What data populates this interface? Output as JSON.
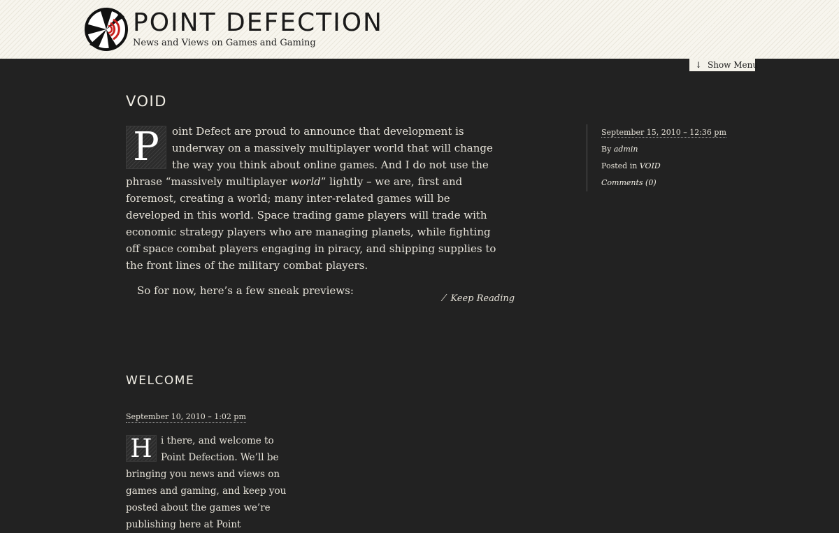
{
  "site": {
    "title": "POINT DEFECTION",
    "tagline": "News and Views on Games and Gaming"
  },
  "menu": {
    "toggle_label": "Show Menu",
    "toggle_icon": "down-arrow-icon"
  },
  "posts": [
    {
      "title": "VOID",
      "dropcap": "P",
      "lead": "oint Defect are proud to announce that development is underway on a massively multiplayer world that will change the way you think about online games. And I do not use the phrase “massively multiplayer ",
      "lead_em": "world",
      "lead_rest": "” lightly – we are, first and foremost, creating a world; many inter-related games will be developed in this world. Space trading game players will trade with economic strategy players who are managing planets, while fighting off space combat players engaging in piracy, and shipping supplies to the front lines of the military combat players.",
      "para2": "So for now, here’s a few sneak previews:",
      "keep_reading": "Keep Reading",
      "meta": {
        "date": "September 15, 2010 – 12:36 pm",
        "by_label": "By",
        "author": "admin",
        "posted_label": "Posted in",
        "category": "VOID",
        "comments": "Comments (0)"
      }
    },
    {
      "title": "WELCOME",
      "date": "September 10, 2010 – 1:02 pm",
      "dropcap": "H",
      "lead": "i there, and welcome to Point Defection. We’ll be bringing you news and views on games and gaming, and keep you posted about the games we’re publishing here at Point"
    }
  ],
  "colors": {
    "background": "#222222",
    "header_bg": "#f7f5ee",
    "logo_accent": "#c8201e"
  }
}
